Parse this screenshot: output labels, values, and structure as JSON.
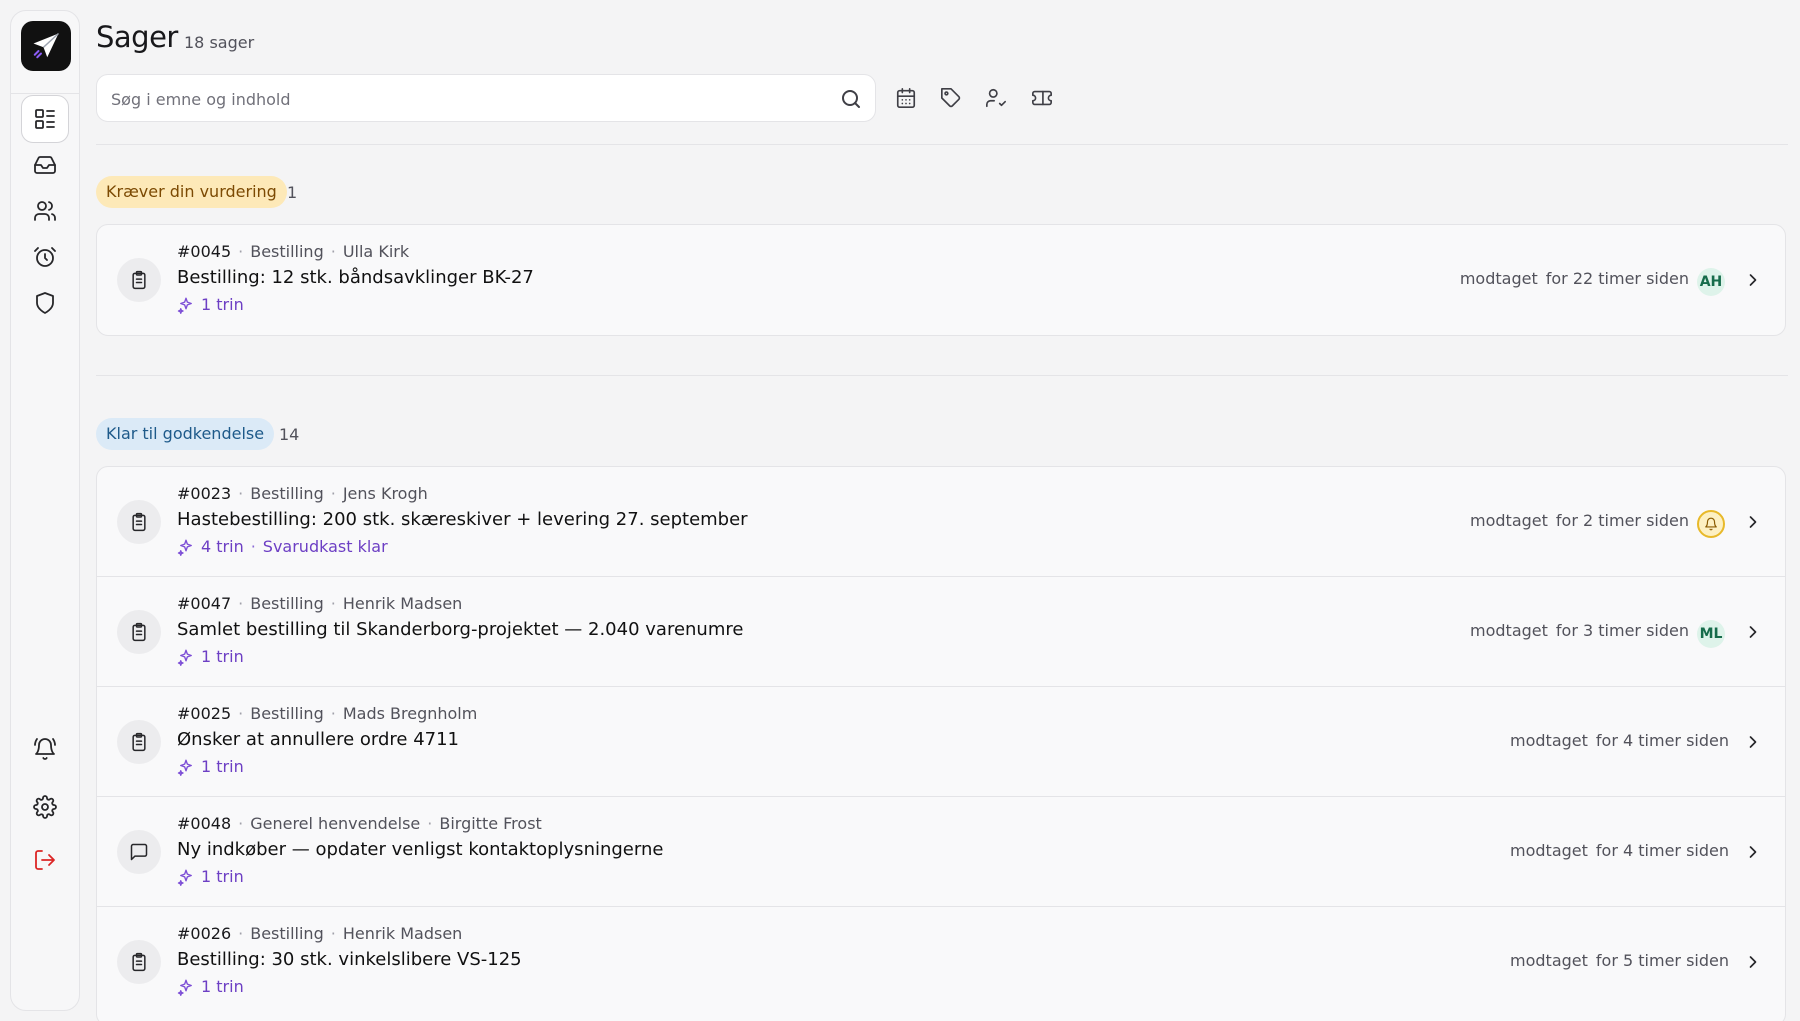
{
  "page": {
    "title": "Sager",
    "count": "18 sager"
  },
  "search": {
    "placeholder": "Søg i emne og indhold"
  },
  "sidebar": {
    "items": [
      {
        "name": "cases",
        "icon": "list-icon",
        "active": true
      },
      {
        "name": "inbox",
        "icon": "inbox-icon"
      },
      {
        "name": "contacts",
        "icon": "users-icon"
      },
      {
        "name": "reminders",
        "icon": "alarm-clock-icon"
      },
      {
        "name": "security",
        "icon": "shield-icon"
      }
    ],
    "bottom": [
      {
        "name": "notifications",
        "icon": "bell-ring-icon"
      },
      {
        "name": "settings",
        "icon": "gear-icon"
      },
      {
        "name": "logout",
        "icon": "log-out-icon",
        "color": "#dc2626"
      }
    ]
  },
  "filters": [
    "calendar-icon",
    "tag-icon",
    "user-check-icon",
    "ticket-icon"
  ],
  "groups": [
    {
      "label": "Kræver din vurdering",
      "count": "1",
      "color": "#fde9b8",
      "cases": [
        {
          "id": "#0045",
          "type": "Bestilling",
          "person": "Ulla Kirk",
          "subject": "Bestilling: 12 stk. båndsavklinger BK-27",
          "steps": "1 trin",
          "extra": "",
          "received_label": "modtaget",
          "received_time": "for 22 timer siden",
          "assignee": "AH",
          "icon": "clipboard-icon"
        }
      ]
    },
    {
      "label": "Klar til godkendelse",
      "count": "14",
      "color": "#dbeaf7",
      "cases": [
        {
          "id": "#0023",
          "type": "Bestilling",
          "person": "Jens Krogh",
          "subject": "Hastebestilling: 200 stk. skæreskiver + levering 27. september",
          "steps": "4 trin",
          "extra": "Svarudkast klar",
          "received_label": "modtaget",
          "received_time": "for 2 timer siden",
          "assignee": "bell",
          "icon": "clipboard-icon"
        },
        {
          "id": "#0047",
          "type": "Bestilling",
          "person": "Henrik Madsen",
          "subject": "Samlet bestilling til Skanderborg-projektet — 2.040 varenumre",
          "steps": "1 trin",
          "extra": "",
          "received_label": "modtaget",
          "received_time": "for 3 timer siden",
          "assignee": "ML",
          "icon": "clipboard-icon"
        },
        {
          "id": "#0025",
          "type": "Bestilling",
          "person": "Mads Bregnholm",
          "subject": "Ønsker at annullere ordre 4711",
          "steps": "1 trin",
          "extra": "",
          "received_label": "modtaget",
          "received_time": "for 4 timer siden",
          "assignee": "",
          "icon": "clipboard-icon"
        },
        {
          "id": "#0048",
          "type": "Generel henvendelse",
          "person": "Birgitte Frost",
          "subject": "Ny indkøber — opdater venligst kontaktoplysningerne",
          "steps": "1 trin",
          "extra": "",
          "received_label": "modtaget",
          "received_time": "for 4 timer siden",
          "assignee": "",
          "icon": "message-square-icon"
        },
        {
          "id": "#0026",
          "type": "Bestilling",
          "person": "Henrik Madsen",
          "subject": "Bestilling: 30 stk. vinkelslibere VS-125",
          "steps": "1 trin",
          "extra": "",
          "received_label": "modtaget",
          "received_time": "for 5 timer siden",
          "assignee": "",
          "icon": "clipboard-icon"
        }
      ]
    }
  ]
}
